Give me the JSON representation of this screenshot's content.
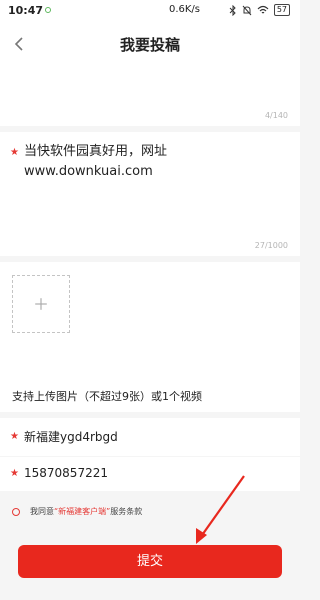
{
  "status_bar": {
    "time": "10:47",
    "network_speed": "0.6K/s",
    "battery": "57"
  },
  "header": {
    "title": "我要投稿"
  },
  "title_field": {
    "value": "",
    "counter": "4/140"
  },
  "content_field": {
    "value": "当快软件园真好用，网址www.downkuai.com",
    "counter": "27/1000"
  },
  "upload": {
    "hint": "支持上传图片（不超过9张）或1个视频"
  },
  "name_field": {
    "value": "新福建ygd4rbgd"
  },
  "phone_field": {
    "value": "15870857221"
  },
  "agreement": {
    "prefix": "我同意",
    "link_text": "“新福建客户端”",
    "suffix": "服务条款"
  },
  "submit": {
    "label": "提交"
  },
  "colors": {
    "accent": "#e8281e",
    "background": "#f5f5f5",
    "counter": "#b5b5b5"
  },
  "icons": {
    "back": "back-arrow-icon",
    "plus": "plus-icon",
    "required": "required-star-icon"
  }
}
